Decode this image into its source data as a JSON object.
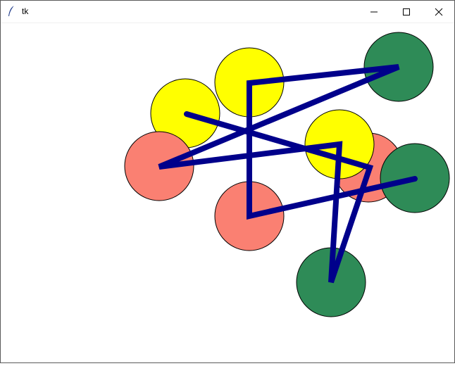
{
  "window": {
    "title": "tk",
    "controls": {
      "minimize_icon": "minimize-icon",
      "maximize_icon": "maximize-icon",
      "close_icon": "close-icon"
    }
  },
  "canvas": {
    "background": "#ffffff",
    "line_color": "#00008b",
    "colors": {
      "salmon": "#fa8072",
      "yellow": "#ffff00",
      "green": "#2e8b57"
    }
  }
}
